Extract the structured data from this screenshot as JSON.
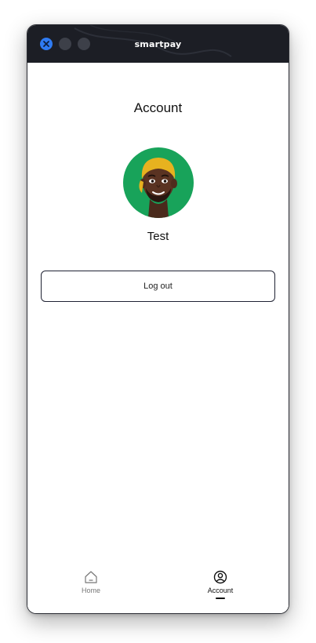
{
  "window": {
    "title": "smartpay"
  },
  "page": {
    "title": "Account",
    "user_name": "Test",
    "logout_label": "Log out"
  },
  "bottom_nav": {
    "items": [
      {
        "label": "Home",
        "icon": "home-icon",
        "active": false
      },
      {
        "label": "Account",
        "icon": "account-icon",
        "active": true
      }
    ]
  },
  "colors": {
    "titlebar": "#1c1e25",
    "close_button": "#2f7bf2",
    "avatar_bg": "#18a35a",
    "text": "#111111"
  }
}
